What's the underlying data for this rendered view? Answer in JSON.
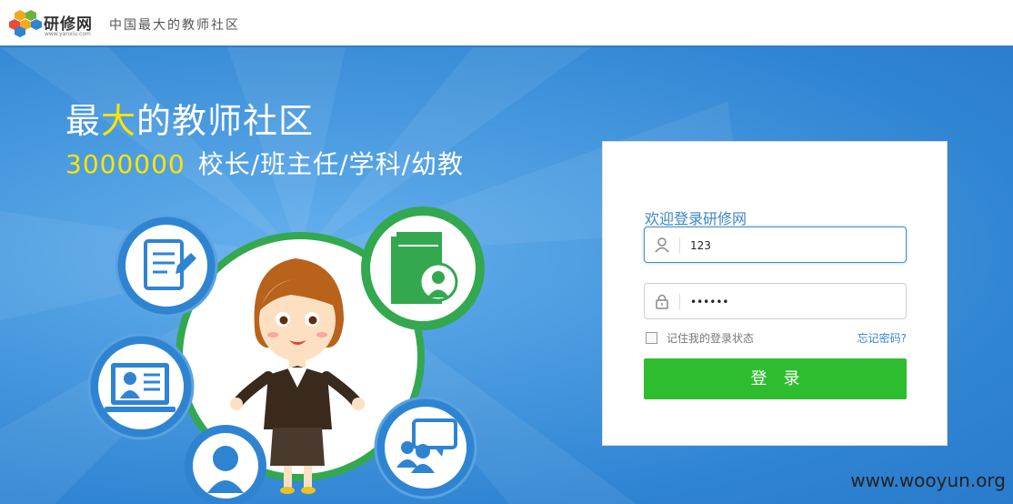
{
  "header": {
    "logo_text": "研修网",
    "logo_sub": "www.yanxiu.com",
    "slogan": "中国最大的教师社区"
  },
  "hero": {
    "headline_part1": "最",
    "headline_highlight": "大",
    "headline_part2": "的教师社区",
    "count": "3000000",
    "categories": "校长/班主任/学科/幼教",
    "illustration_icons": [
      "document-icon",
      "book-icon",
      "teacher-screen-icon",
      "support-agent-icon",
      "discussion-icon",
      "teacher-character"
    ]
  },
  "login": {
    "welcome": "欢迎登录研修网",
    "username_value": "123",
    "password_value": "••••••",
    "remember_label": "记住我的登录状态",
    "forgot_label": "忘记密码?",
    "submit_label": "登　录"
  },
  "watermark": "www.wooyun.org",
  "colors": {
    "header_border": "#2f7fc4",
    "hero_blue": "#4a9be0",
    "highlight_yellow": "#ffe400",
    "login_button": "#2ebd2e",
    "link_blue": "#3a86c8"
  }
}
